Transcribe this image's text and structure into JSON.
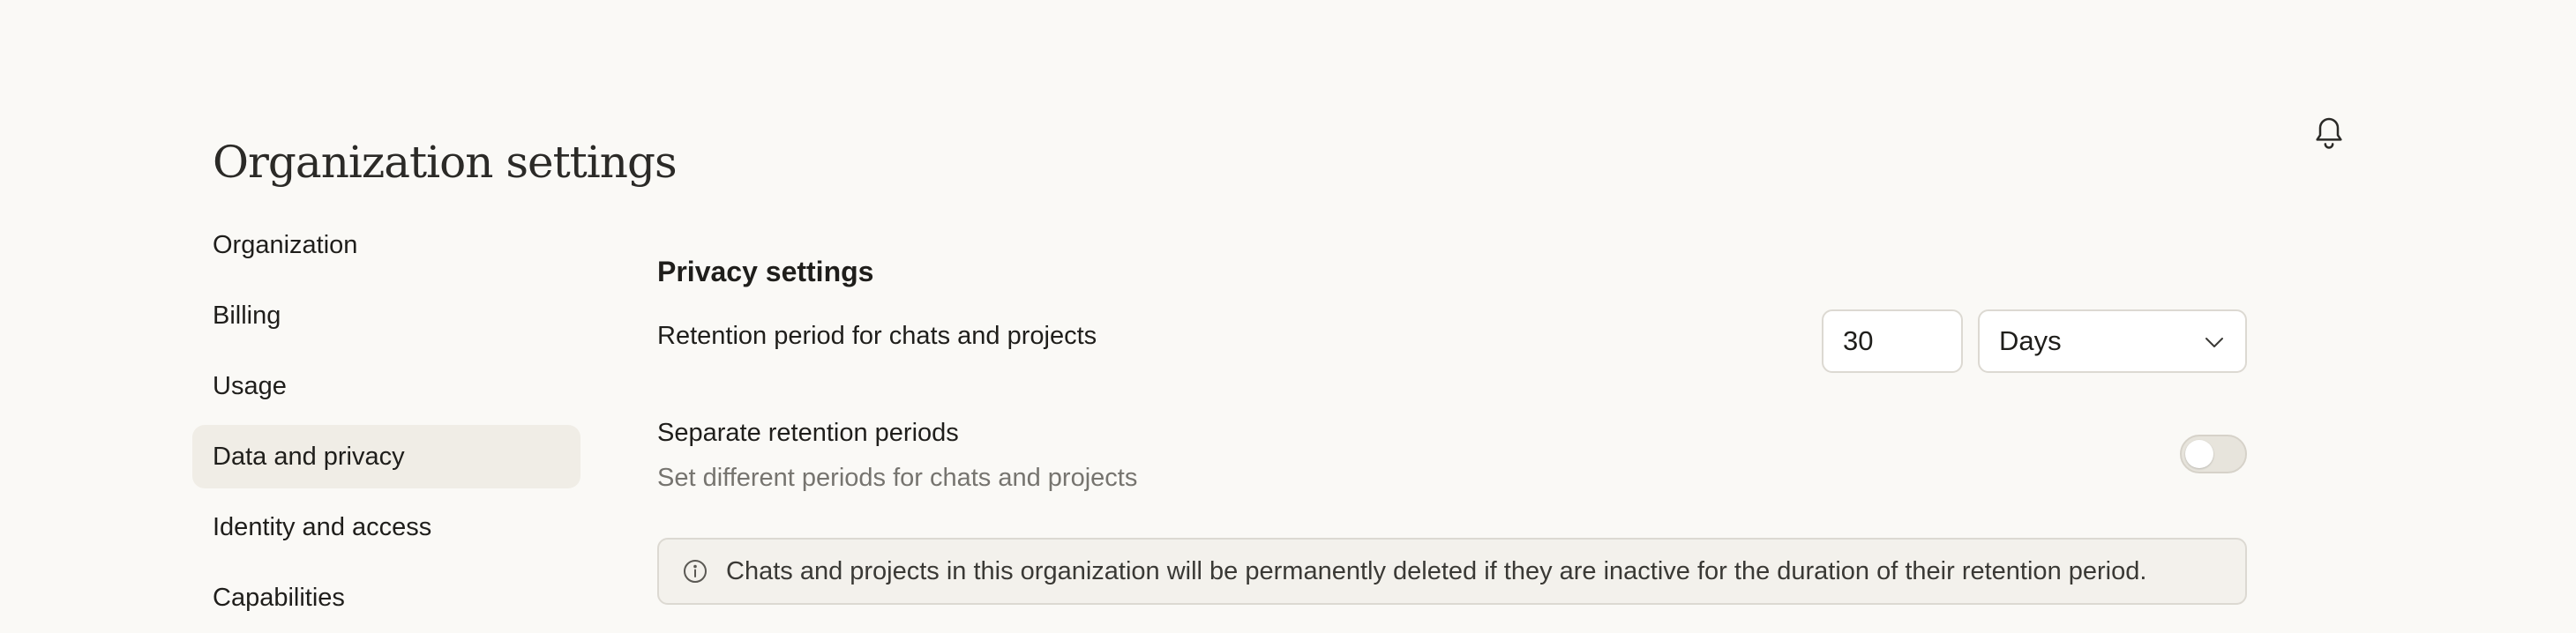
{
  "header": {
    "title": "Organization settings",
    "notifications_icon": "bell-icon"
  },
  "sidebar": {
    "items": [
      {
        "label": "Organization",
        "active": false
      },
      {
        "label": "Billing",
        "active": false
      },
      {
        "label": "Usage",
        "active": false
      },
      {
        "label": "Data and privacy",
        "active": true
      },
      {
        "label": "Identity and access",
        "active": false
      },
      {
        "label": "Capabilities",
        "active": false
      }
    ]
  },
  "privacy": {
    "section_title": "Privacy settings",
    "retention": {
      "label": "Retention period for chats and projects",
      "value": "30",
      "unit": "Days",
      "unit_icon": "chevron-down-icon"
    },
    "separate": {
      "label": "Separate retention periods",
      "description": "Set different periods for chats and projects",
      "enabled": false
    },
    "notice": {
      "icon": "info-icon",
      "text": "Chats and projects in this organization will be permanently deleted if they are inactive for the duration of their retention period."
    }
  },
  "colors": {
    "background": "#faf9f6",
    "active_nav": "#f0ede6",
    "muted_text": "#76746f",
    "border": "#dcd9d2"
  }
}
